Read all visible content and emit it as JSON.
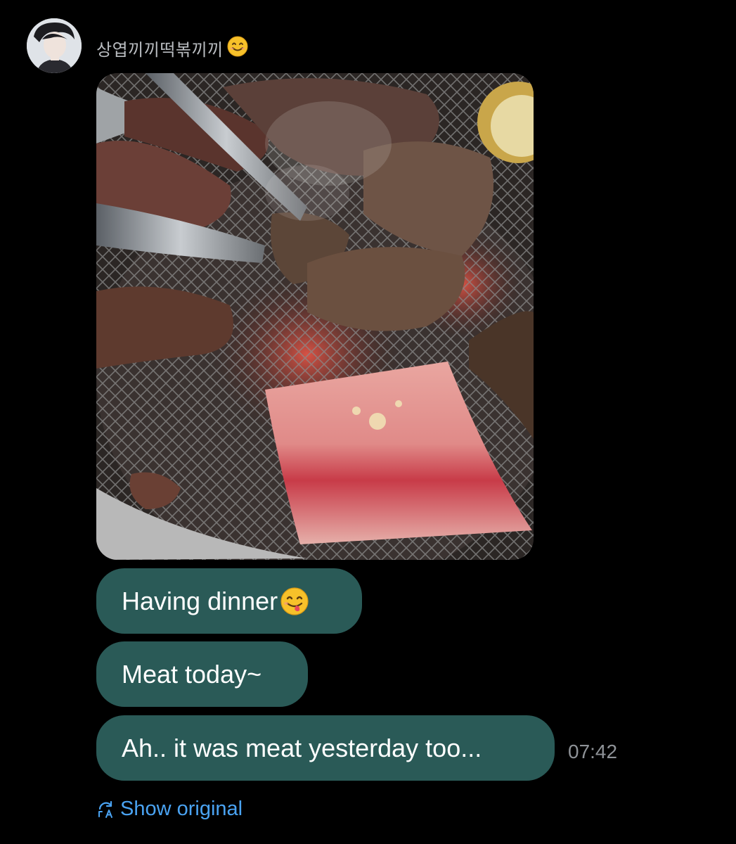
{
  "sender": {
    "name": "상엽끼끼떡볶끼끼",
    "emoji": "smiling-face-icon"
  },
  "photo": {
    "description_icon": "grilled-meat-photo"
  },
  "messages": [
    {
      "text": "Having dinner",
      "emoji": "face-savoring-food-icon"
    },
    {
      "text": "Meat today~"
    },
    {
      "text": "Ah.. it was meat yesterday too..."
    }
  ],
  "timestamp": "07:42",
  "translation": {
    "label": "Show original",
    "icon": "translate-refresh-icon",
    "color": "#4aa3f2"
  },
  "colors": {
    "background": "#000000",
    "bubble": "#2a5a57",
    "bubble_text": "#ffffff",
    "timestamp": "#8e9297"
  }
}
